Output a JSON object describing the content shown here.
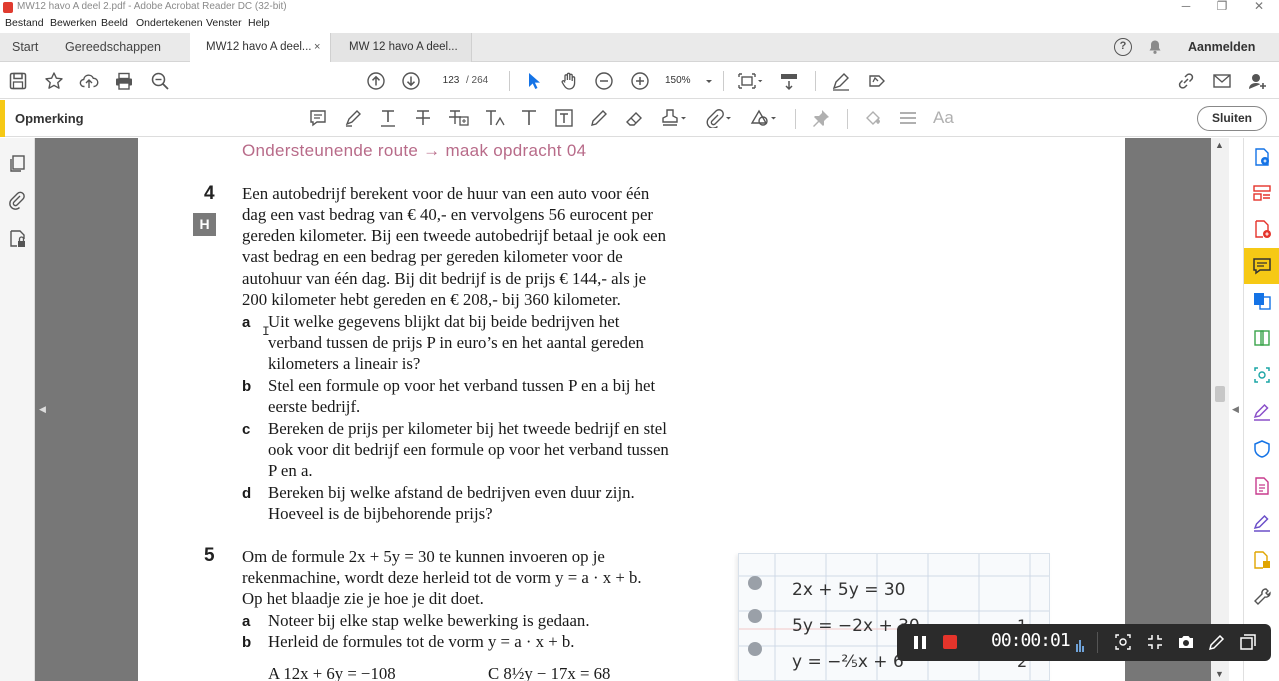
{
  "window": {
    "title": "MW12 havo A deel 2.pdf - Adobe Acrobat Reader DC (32-bit)",
    "minimize": "─",
    "maximize": "❐",
    "close": "✕"
  },
  "menu": [
    "Bestand",
    "Bewerken",
    "Beeld",
    "Ondertekenen",
    "Venster",
    "Help"
  ],
  "tabs": {
    "home": "Start",
    "tools": "Gereedschappen",
    "documents": [
      {
        "label": "MW12 havo A deel...",
        "active": true,
        "close": "×"
      },
      {
        "label": "MW 12 havo A deel...",
        "active": false
      }
    ],
    "help_glyph": "?",
    "sign_in": "Aanmelden"
  },
  "toolbar": {
    "current_page": "123",
    "page_total": "/ 264",
    "zoom": "150%"
  },
  "comment_toolbar": {
    "label": "Opmerking",
    "close_button": "Sluiten",
    "text_size_glyph": "Aa"
  },
  "document": {
    "route_heading": "Ondersteunende route → maak opdracht 04",
    "exercise4": {
      "number": "4",
      "badge": "H",
      "intro": [
        "Een autobedrijf berekent voor de huur van een auto voor één",
        "dag een vast bedrag van € 40,- en vervolgens 56 eurocent per",
        "gereden kilometer. Bij een tweede autobedrijf betaal je ook een",
        "vast bedrag en een bedrag per gereden kilometer voor de",
        "autohuur van één dag. Bij dit bedrijf is de prijs € 144,- als je",
        "200 kilometer hebt gereden en € 208,- bij 360 kilometer."
      ],
      "parts": [
        {
          "letter": "a",
          "lines": [
            "Uit welke gegevens blijkt dat bij beide bedrijven het",
            "verband tussen de prijs P in euro’s en het aantal gereden",
            "kilometers a lineair is?"
          ]
        },
        {
          "letter": "b",
          "lines": [
            "Stel een formule op voor het verband tussen P en a bij het",
            "eerste bedrijf."
          ]
        },
        {
          "letter": "c",
          "lines": [
            "Bereken de prijs per kilometer bij het tweede bedrijf en stel",
            "ook voor dit bedrijf een formule op voor het verband tussen",
            "P en a."
          ]
        },
        {
          "letter": "d",
          "lines": [
            "Bereken bij welke afstand de bedrijven even duur zijn.",
            "Hoeveel is de bijbehorende prijs?"
          ]
        }
      ]
    },
    "exercise5": {
      "number": "5",
      "intro": [
        "Om de formule 2x + 5y = 30 te kunnen invoeren op je",
        "rekenmachine, wordt deze herleid tot de vorm y = a · x + b.",
        "Op het blaadje zie je hoe je dit doet."
      ],
      "parts": [
        {
          "letter": "a",
          "lines": [
            "Noteer bij elke stap welke bewerking is gedaan."
          ]
        },
        {
          "letter": "b",
          "lines": [
            "Herleid de formules tot de vorm y = a · x + b."
          ]
        }
      ],
      "formula_row": {
        "A": "A   12x + 6y = −108",
        "C": "C   8½y − 17x = 68"
      }
    },
    "grid_paper": {
      "lines": [
        "2x + 5y = 30",
        "5y = −2x + 30",
        "y = −⅖x + 6"
      ],
      "margin_marks": [
        "1",
        "2"
      ]
    }
  },
  "recorder": {
    "timer": "00:00:01"
  },
  "colors": {
    "accent_yellow": "#f6c915",
    "heading_pink": "#b86b89",
    "recording_red": "#e5342b",
    "acrobat_blue": "#1473e6"
  }
}
